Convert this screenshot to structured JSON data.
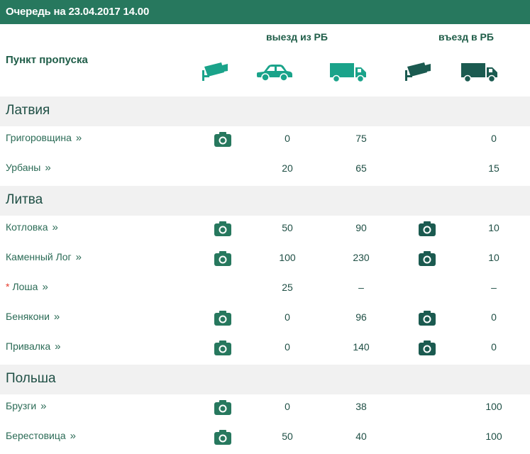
{
  "header": {
    "title": "Очередь на 23.04.2017 14.00"
  },
  "table_head": {
    "point_label": "Пункт пропуска",
    "exit_label": "выезд из РБ",
    "entry_label": "въезд в РБ"
  },
  "icons": {
    "exit_camera": "cctv-camera-icon",
    "exit_car": "car-icon",
    "exit_truck": "truck-icon",
    "entry_camera": "cctv-camera-icon",
    "entry_truck": "truck-icon"
  },
  "colors": {
    "header_bg": "#27785e",
    "accent": "#27785e",
    "exit_icons": "#1aa38a",
    "entry_icons": "#1b5a50",
    "country_bg": "#f1f1f1",
    "star": "#e53b2c"
  },
  "countries": [
    {
      "name": "Латвия",
      "points": [
        {
          "name": "Григоровщина",
          "starred": false,
          "exit_camera": true,
          "exit_cars": "0",
          "exit_trucks": "75",
          "entry_camera": false,
          "entry_trucks": "0"
        },
        {
          "name": "Урбаны",
          "starred": false,
          "exit_camera": false,
          "exit_cars": "20",
          "exit_trucks": "65",
          "entry_camera": false,
          "entry_trucks": "15"
        }
      ]
    },
    {
      "name": "Литва",
      "points": [
        {
          "name": "Котловка",
          "starred": false,
          "exit_camera": true,
          "exit_cars": "50",
          "exit_trucks": "90",
          "entry_camera": true,
          "entry_trucks": "10"
        },
        {
          "name": "Каменный Лог",
          "starred": false,
          "exit_camera": true,
          "exit_cars": "100",
          "exit_trucks": "230",
          "entry_camera": true,
          "entry_trucks": "10"
        },
        {
          "name": "Лоша",
          "starred": true,
          "star": "*",
          "exit_camera": false,
          "exit_cars": "25",
          "exit_trucks": "–",
          "entry_camera": false,
          "entry_trucks": "–"
        },
        {
          "name": "Бенякони",
          "starred": false,
          "exit_camera": true,
          "exit_cars": "0",
          "exit_trucks": "96",
          "entry_camera": true,
          "entry_trucks": "0"
        },
        {
          "name": "Привалка",
          "starred": false,
          "exit_camera": true,
          "exit_cars": "0",
          "exit_trucks": "140",
          "entry_camera": true,
          "entry_trucks": "0"
        }
      ]
    },
    {
      "name": "Польша",
      "points": [
        {
          "name": "Брузги",
          "starred": false,
          "exit_camera": true,
          "exit_cars": "0",
          "exit_trucks": "38",
          "entry_camera": false,
          "entry_trucks": "100"
        },
        {
          "name": "Берестовица",
          "starred": false,
          "exit_camera": true,
          "exit_cars": "50",
          "exit_trucks": "40",
          "entry_camera": false,
          "entry_trucks": "100"
        }
      ]
    }
  ],
  "link_chevron": "»"
}
